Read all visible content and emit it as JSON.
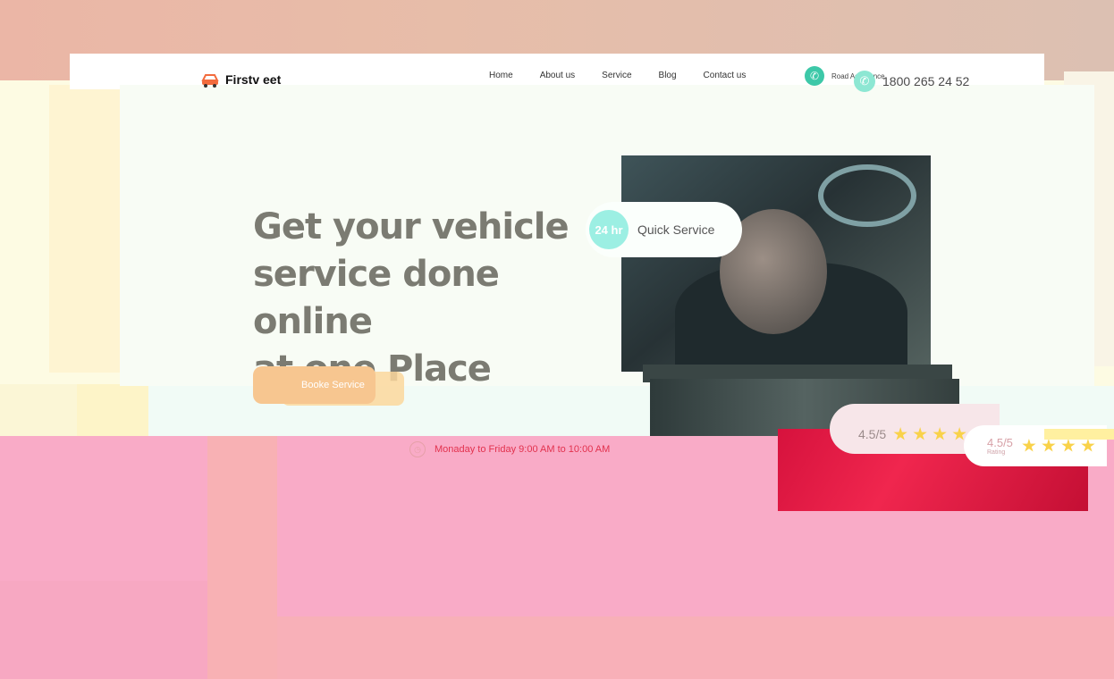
{
  "brand": {
    "name": "Firstv eet"
  },
  "nav": {
    "items": [
      "Home",
      "About us",
      "Service",
      "Blog",
      "Contact us"
    ]
  },
  "header": {
    "assistance_label": "Road Assistance",
    "phone": "1800 265 24 52"
  },
  "hero": {
    "title_line1": "Get your vehicle",
    "title_line2": "service done online",
    "title_line3": "at one Place",
    "cta_label": "Booke Service"
  },
  "quick_service": {
    "badge": "24 hr",
    "label": "Quick Service"
  },
  "hours": {
    "text": "Monaday to Friday 9:00 AM to 10:00 AM"
  },
  "rating": {
    "value": "4.5/5",
    "sub_label": "Rating",
    "stars": 4.5
  },
  "colors": {
    "accent": "#f7c690",
    "teal": "#3dc8a8",
    "star": "#f9d24a",
    "red": "#e2324e"
  }
}
